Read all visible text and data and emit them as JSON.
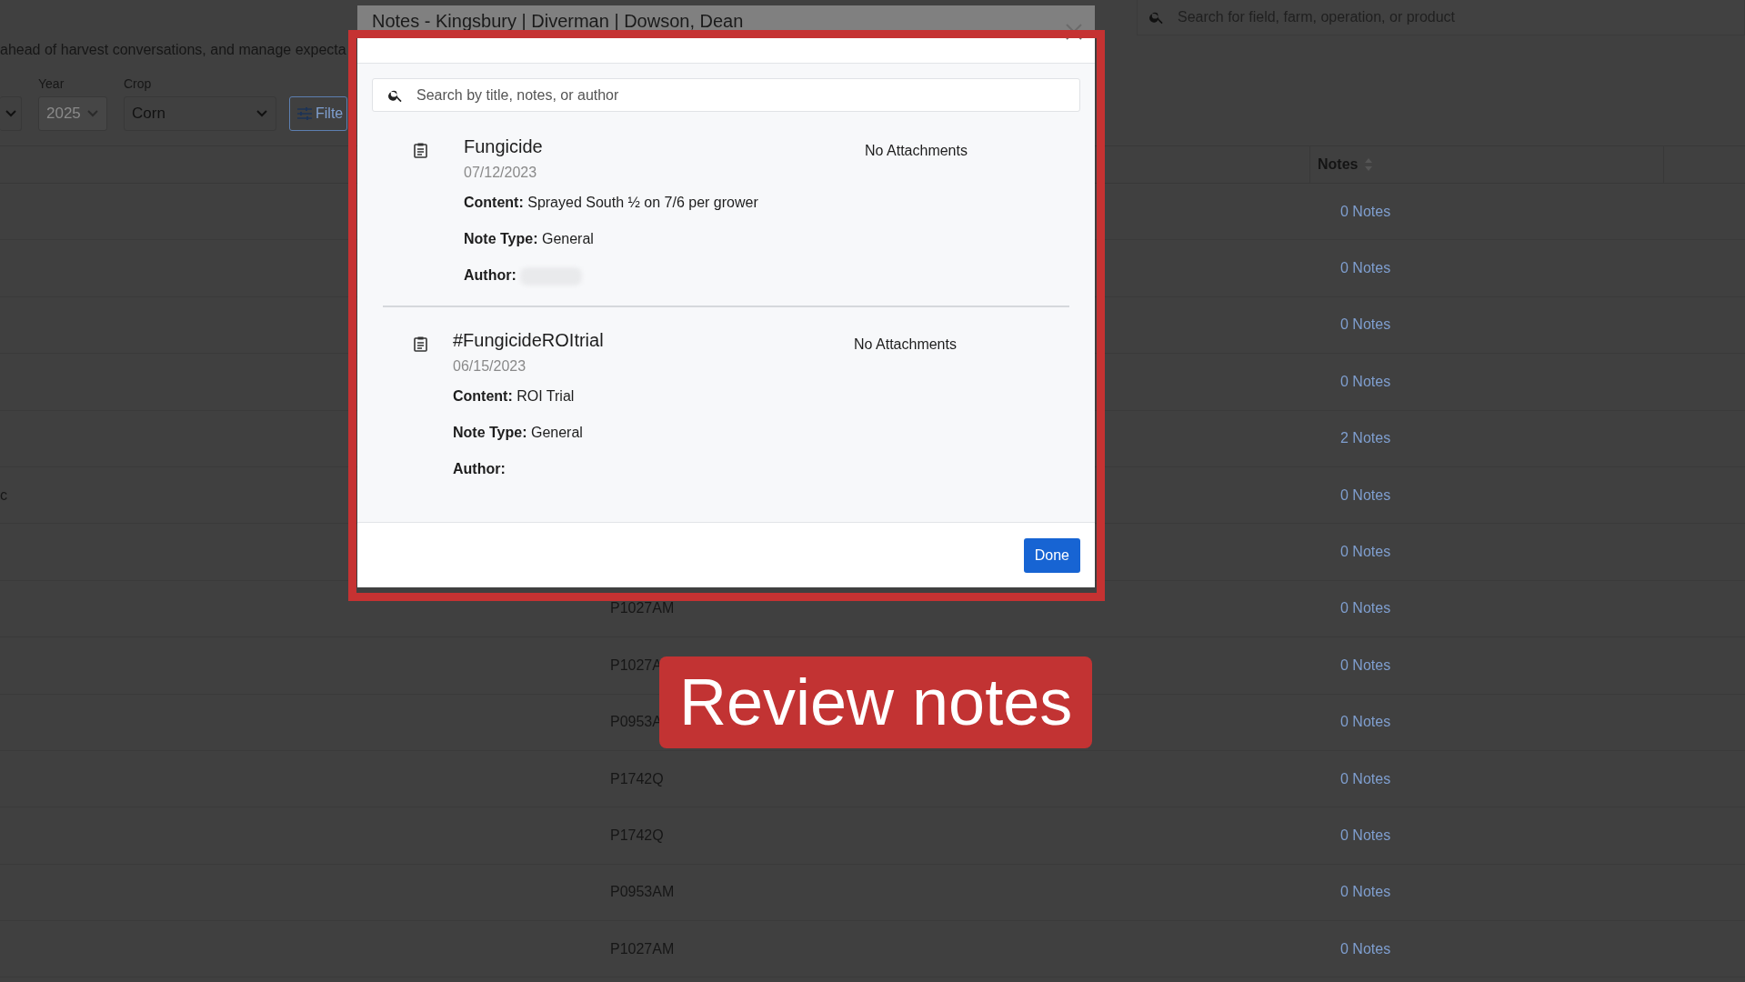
{
  "page": {
    "intro_text": "ahead of harvest conversations, and manage expecta",
    "search": {
      "placeholder": "Search for field, farm, operation, or product"
    },
    "year": {
      "label": "Year",
      "value": "2025",
      "disabled": true
    },
    "crop": {
      "label": "Crop",
      "value": "Corn",
      "disabled": false
    },
    "filter_button": "Filte"
  },
  "table": {
    "columns": [
      {
        "label": "Notes",
        "sortable": true
      }
    ],
    "rows": [
      {
        "notes": "0 Notes"
      },
      {
        "notes": "0 Notes"
      },
      {
        "notes": "0 Notes"
      },
      {
        "notes": "0 Notes"
      },
      {
        "notes": "2 Notes"
      },
      {
        "column_1": "c",
        "notes": "0 Notes"
      },
      {
        "notes": "0 Notes"
      },
      {
        "column_2": "P1027AM",
        "notes": "0 Notes"
      },
      {
        "column_2": "P1027A",
        "notes": "0 Notes"
      },
      {
        "column_2": "P0953A",
        "notes": "0 Notes"
      },
      {
        "column_2": "P1742Q",
        "notes": "0 Notes"
      },
      {
        "column_2": "P1742Q",
        "notes": "0 Notes"
      },
      {
        "column_2": "P0953AM",
        "notes": "0 Notes"
      },
      {
        "column_2": "P1027AM",
        "notes": "0 Notes"
      }
    ]
  },
  "modal": {
    "title": "Notes - Kingsbury | Diverman | Dowson, Dean",
    "search": {
      "placeholder": "Search by title, notes, or author"
    },
    "notes": [
      {
        "title": "Fungicide",
        "date": "07/12/2023",
        "content": "**Content:** Sprayed South ½ on 7/6 per grower",
        "note_type": "**Note Type:** General",
        "author": "**Author:**",
        "author_redacted": true,
        "attachments": "No Attachments"
      },
      {
        "title": "#FungicideROItrial",
        "date": "06/15/2023",
        "content": "**Content:** ROI Trial",
        "note_type": "**Note Type:** General",
        "author": "**Author:**",
        "author_redacted": false,
        "attachments": "No Attachments"
      }
    ],
    "done_button": "Done"
  },
  "callout": {
    "text": "Review notes"
  }
}
